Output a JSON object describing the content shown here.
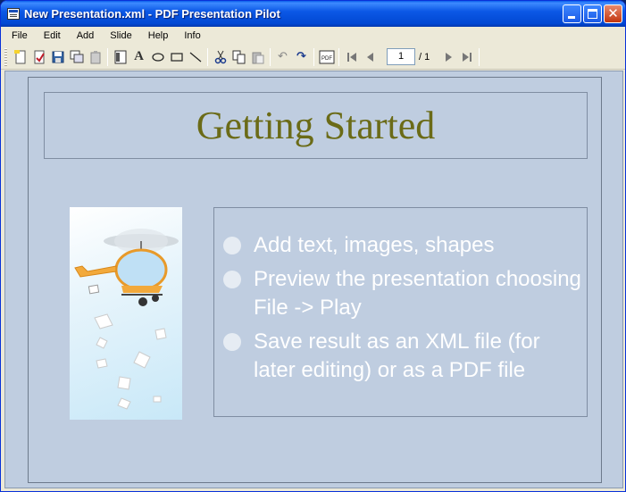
{
  "window": {
    "title": "New Presentation.xml - PDF Presentation Pilot"
  },
  "menu": {
    "items": [
      "File",
      "Edit",
      "Add",
      "Slide",
      "Help",
      "Info"
    ]
  },
  "toolbar": {
    "page_current": "1",
    "page_total": "/ 1",
    "pdf_label": "PDF",
    "icons": [
      "new-icon",
      "open-icon",
      "save-icon",
      "copy-slide-icon",
      "paste-slide-icon",
      "layout-icon",
      "text-icon",
      "ellipse-icon",
      "rectangle-icon",
      "line-icon",
      "cut-icon",
      "copy-icon",
      "paste-icon",
      "undo-icon",
      "redo-icon",
      "pdf-icon",
      "first-page-icon",
      "prev-page-icon",
      "next-page-icon",
      "last-page-icon"
    ]
  },
  "slide": {
    "title": "Getting Started",
    "title_color": "#6b6b17",
    "bullets": [
      "Add text, images, shapes",
      "Preview the presentation choosing File -> Play",
      "Save result as an XML file (for later editing) or as a PDF file"
    ],
    "background_color": "#bfcde0"
  }
}
